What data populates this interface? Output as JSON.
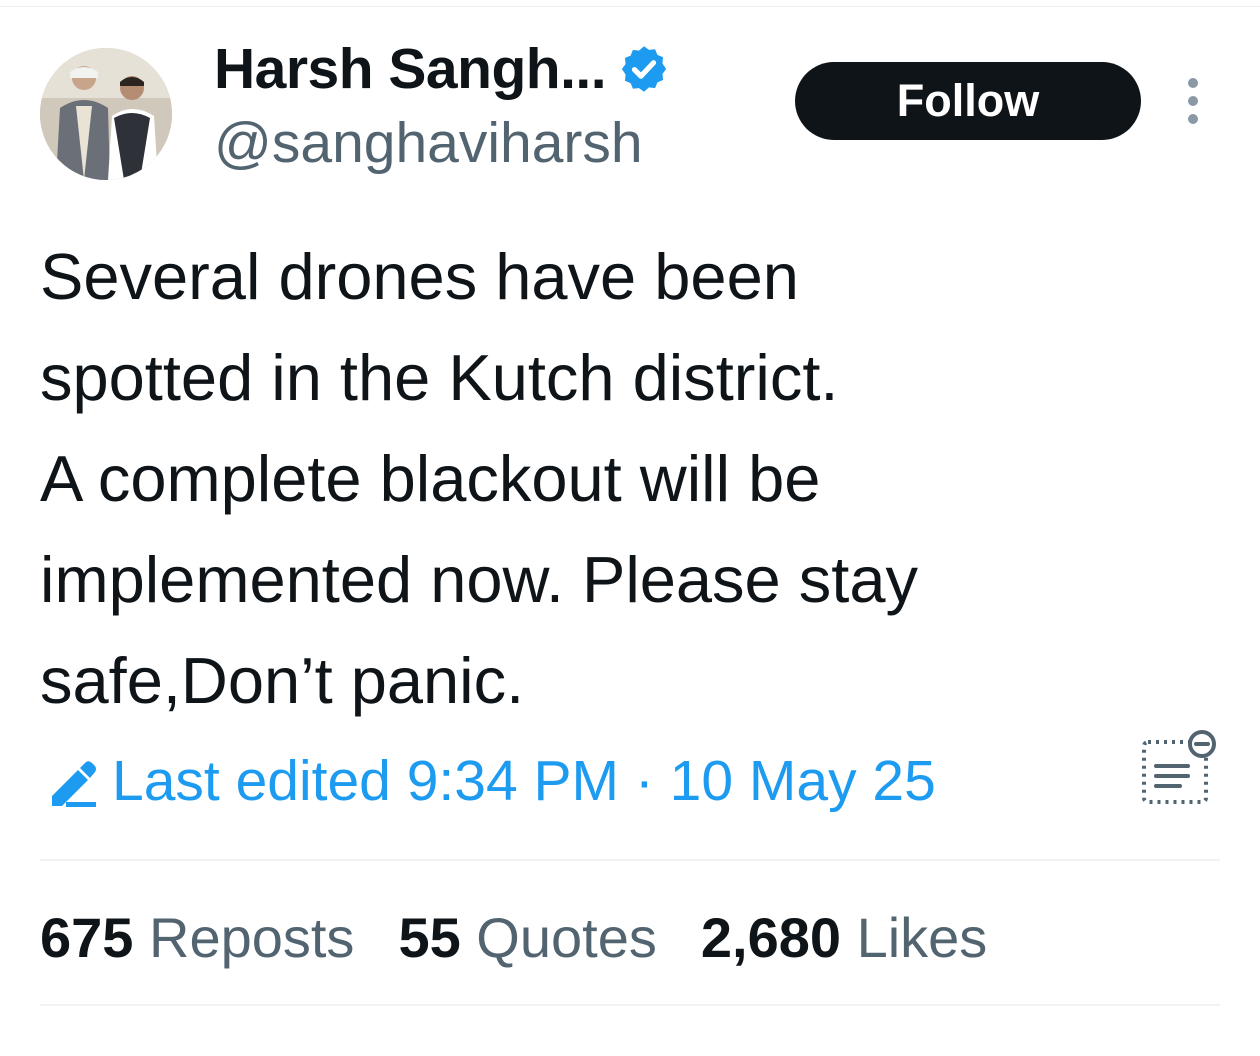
{
  "author": {
    "display_name": "Harsh Sangh...",
    "handle": "@sanghaviharsh",
    "verified": true
  },
  "actions": {
    "follow_label": "Follow",
    "more_icon": "more-vertical-icon"
  },
  "tweet": {
    "lines": [
      "Several drones have been",
      "spotted in the Kutch district.",
      "A complete blackout will be",
      "implemented now. Please stay",
      "safe,Don’t panic."
    ],
    "edited_text": "Last edited 9:34 PM · 10 May 25"
  },
  "stats": {
    "reposts_count": "675",
    "reposts_label": "Reposts",
    "quotes_count": "55",
    "quotes_label": "Quotes",
    "likes_count": "2,680",
    "likes_label": "Likes"
  },
  "colors": {
    "text": "#0f1419",
    "secondary": "#536471",
    "accent": "#1d9bf0",
    "button": "#0f1419"
  }
}
